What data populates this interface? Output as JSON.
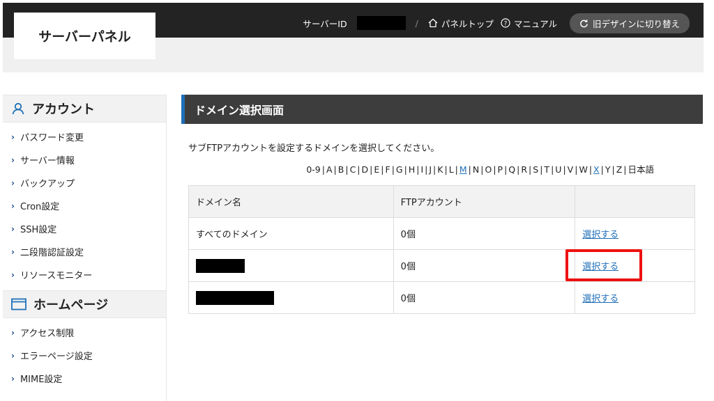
{
  "header": {
    "logo_text": "サーバーパネル",
    "server_id_label": "サーバーID",
    "separator": "/",
    "panel_top": "パネルトップ",
    "manual": "マニュアル",
    "old_design": "旧デザインに切り替え"
  },
  "sidebar": {
    "account_heading": "アカウント",
    "account_items": [
      "パスワード変更",
      "サーバー情報",
      "バックアップ",
      "Cron設定",
      "SSH設定",
      "二段階認証設定",
      "リソースモニター"
    ],
    "homepage_heading": "ホームページ",
    "homepage_items": [
      "アクセス制限",
      "エラーページ設定",
      "MIME設定"
    ]
  },
  "main": {
    "title": "ドメイン選択画面",
    "instructions": "サブFTPアカウントを設定するドメインを選択してください。",
    "alpha_nav": [
      {
        "label": "0-9",
        "link": false
      },
      {
        "label": "A",
        "link": false
      },
      {
        "label": "B",
        "link": false
      },
      {
        "label": "C",
        "link": false
      },
      {
        "label": "D",
        "link": false
      },
      {
        "label": "E",
        "link": false
      },
      {
        "label": "F",
        "link": false
      },
      {
        "label": "G",
        "link": false
      },
      {
        "label": "H",
        "link": false
      },
      {
        "label": "I",
        "link": false
      },
      {
        "label": "J",
        "link": false
      },
      {
        "label": "K",
        "link": false
      },
      {
        "label": "L",
        "link": false
      },
      {
        "label": "M",
        "link": true
      },
      {
        "label": "N",
        "link": false
      },
      {
        "label": "O",
        "link": false
      },
      {
        "label": "P",
        "link": false
      },
      {
        "label": "Q",
        "link": false
      },
      {
        "label": "R",
        "link": false
      },
      {
        "label": "S",
        "link": false
      },
      {
        "label": "T",
        "link": false
      },
      {
        "label": "U",
        "link": false
      },
      {
        "label": "V",
        "link": false
      },
      {
        "label": "W",
        "link": false
      },
      {
        "label": "X",
        "link": true
      },
      {
        "label": "Y",
        "link": false
      },
      {
        "label": "Z",
        "link": false
      },
      {
        "label": "日本語",
        "link": false
      }
    ],
    "table": {
      "headers": [
        "ドメイン名",
        "FTPアカウント",
        ""
      ],
      "rows": [
        {
          "domain": "すべてのドメイン",
          "redacted": false,
          "count": "0個",
          "action": "選択する"
        },
        {
          "domain": "",
          "redacted": true,
          "count": "0個",
          "action": "選択する"
        },
        {
          "domain": "",
          "redacted": true,
          "count": "0個",
          "action": "選択する"
        }
      ]
    }
  },
  "colors": {
    "accent": "#1e6fb8",
    "header_bg": "#232323",
    "highlight": "#ee1111"
  }
}
